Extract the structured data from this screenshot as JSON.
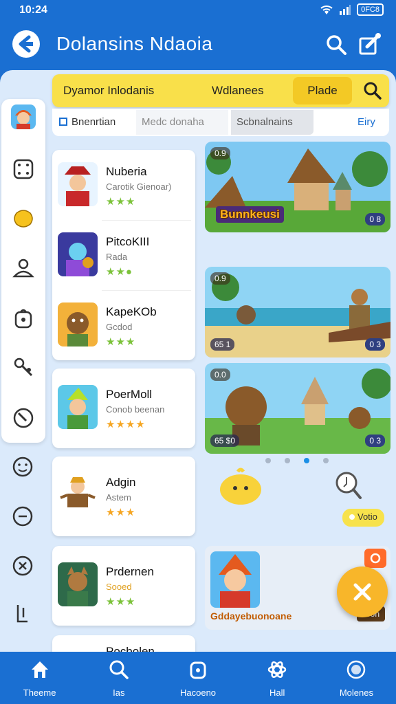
{
  "status_bar": {
    "time": "10:24",
    "battery": "0FC8"
  },
  "header": {
    "title": "Dolansins Ndaoia"
  },
  "filter_bar": {
    "item1": "Dyamor Inlodanis",
    "item2": "Wdlanees",
    "item3": "Plade"
  },
  "tabs": [
    {
      "label": "Bnenrtian"
    },
    {
      "label": "Medc donaha"
    },
    {
      "label": "Scbnalnains"
    },
    {
      "label": "Eiry"
    }
  ],
  "rail_icons": [
    "avatar",
    "dice-icon",
    "puzzle-icon",
    "user-icon",
    "bag-icon",
    "wrench-icon",
    "compass-icon",
    "emoji-icon",
    "chat-icon",
    "tag-icon",
    "signal-icon"
  ],
  "games": [
    {
      "name": "Nuberia",
      "sub": "Carotik Gienoar)",
      "stars": "★★★",
      "star_color": "green"
    },
    {
      "name": "PitcoKIII",
      "sub": "Rada",
      "stars": "★★●",
      "star_color": "green"
    },
    {
      "name": "KapeKOb",
      "sub": "Gcdod",
      "stars": "★★★",
      "star_color": "green"
    },
    {
      "name": "PoerMoll",
      "sub": "Conob beenan",
      "stars": "★★★★",
      "star_color": "orange"
    },
    {
      "name": "Adgin",
      "sub": "Astem",
      "stars": "★★★",
      "star_color": "orange"
    },
    {
      "name": "Prdernen",
      "sub": "Sooed",
      "stars": "★★★",
      "star_color": "green"
    },
    {
      "name": "Pocbolen",
      "sub": "",
      "stars": "",
      "star_color": "green"
    }
  ],
  "banners": [
    {
      "badge_tl": "0.9",
      "title": "Bunnkeusi",
      "badge_br": "0 8"
    },
    {
      "badge_tl": "0.9",
      "badge_bl": "65 1",
      "badge_br": "0 3"
    },
    {
      "badge_tl": "0.0",
      "badge_bl": "65 $0",
      "badge_br": "0 3"
    }
  ],
  "vote_label": "Votio",
  "promo": {
    "label": "Gddayebuonoane",
    "tag": "Pron"
  },
  "bottom_nav": [
    {
      "label": "Theeme",
      "icon": "home-icon"
    },
    {
      "label": "Ias",
      "icon": "search-icon"
    },
    {
      "label": "Hacoeno",
      "icon": "lock-icon"
    },
    {
      "label": "Hall",
      "icon": "atom-icon"
    },
    {
      "label": "Molenes",
      "icon": "globe-icon"
    }
  ],
  "colors": {
    "primary": "#1a6fd2",
    "accent_yellow": "#f9e04a",
    "background": "#dbeafb"
  }
}
